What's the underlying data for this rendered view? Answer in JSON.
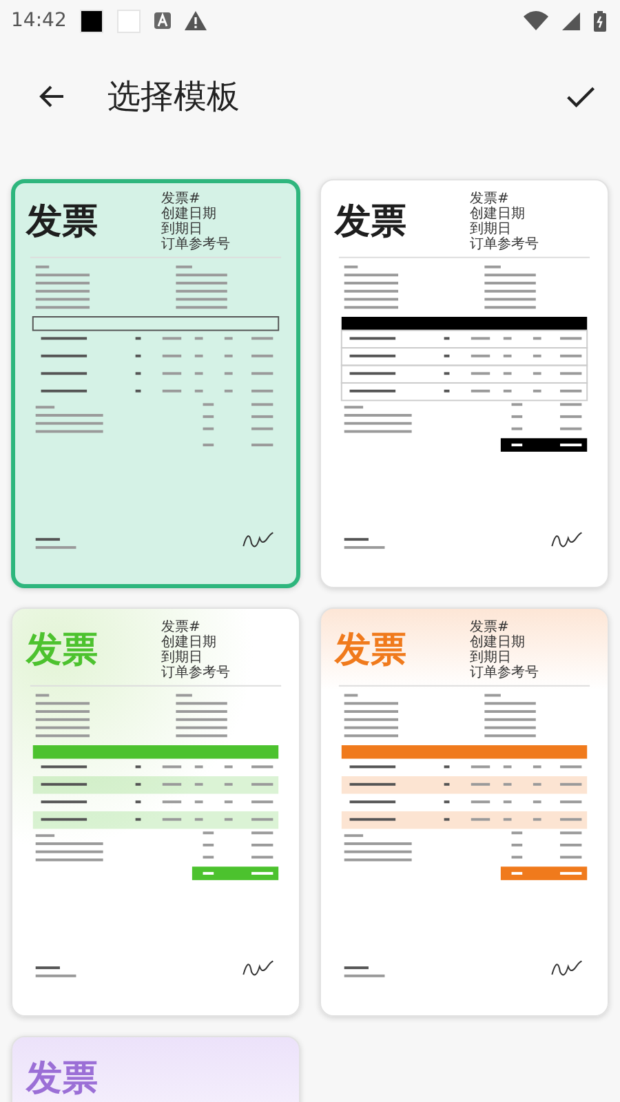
{
  "status_bar": {
    "time": "14:42"
  },
  "toolbar": {
    "title": "选择模板"
  },
  "templates": [
    {
      "kind": "mint",
      "color": "#2eb67d",
      "selected": true,
      "title": "发票",
      "meta": [
        "发票#",
        "创建日期",
        "到期日",
        "订单参考号"
      ]
    },
    {
      "kind": "mono",
      "color": "#000000",
      "selected": false,
      "title": "发票",
      "meta": [
        "发票#",
        "创建日期",
        "到期日",
        "订单参考号"
      ]
    },
    {
      "kind": "green",
      "color": "#4cc22e",
      "selected": false,
      "title": "发票",
      "meta": [
        "发票#",
        "创建日期",
        "到期日",
        "订单参考号"
      ]
    },
    {
      "kind": "orange",
      "color": "#f07a1c",
      "selected": false,
      "title": "发票",
      "meta": [
        "发票#",
        "创建日期",
        "到期日",
        "订单参考号"
      ]
    },
    {
      "kind": "purple",
      "color": "#9b6fd6",
      "selected": false,
      "title": "发票"
    }
  ]
}
